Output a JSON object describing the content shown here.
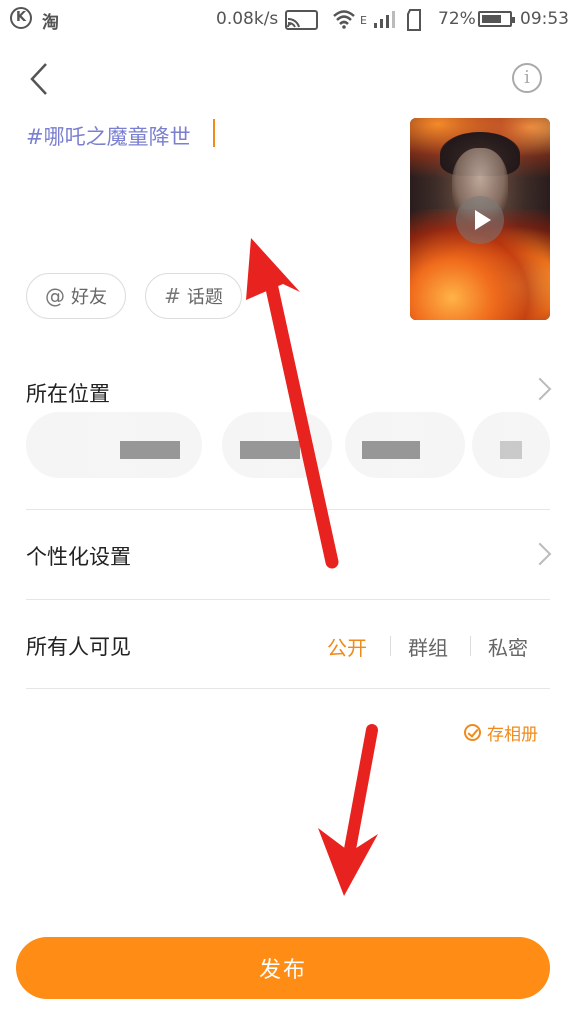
{
  "status_bar": {
    "left_icon_letter": "K",
    "app_icon_text": "淘",
    "speed": "0.08k/s",
    "network_type": "E",
    "battery_percent": "72%",
    "battery_level": 0.72,
    "time": "09:53"
  },
  "header": {
    "back_icon": "chevron-left-icon",
    "info_icon": "info-icon",
    "info_glyph": "i"
  },
  "compose": {
    "topic_text": "#哪吒之魔童降世"
  },
  "chips": {
    "friends_symbol": "@",
    "friends_label": "好友",
    "topic_symbol": "#",
    "topic_label": "话题"
  },
  "location": {
    "label": "所在位置"
  },
  "personalize": {
    "label": "个性化设置"
  },
  "visibility": {
    "label": "所有人可见",
    "options": [
      "公开",
      "群组",
      "私密"
    ],
    "selected_index": 0
  },
  "album": {
    "label": "存相册"
  },
  "publish": {
    "label": "发布"
  },
  "colors": {
    "accent": "#ff8c14",
    "topic": "#7a7fd0",
    "annotation_arrow": "#e8231f"
  }
}
